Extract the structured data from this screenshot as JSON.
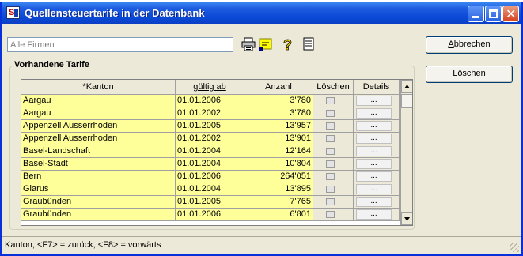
{
  "window": {
    "title": "Quellensteuertarife in der Datenbank"
  },
  "filter": {
    "placeholder": "Alle Firmen"
  },
  "buttons": {
    "cancel": "Abbrechen",
    "delete": "Löschen",
    "cancel_key": "A",
    "delete_key": "L"
  },
  "group": {
    "label": "Vorhandene Tarife"
  },
  "columns": [
    "*Kanton",
    "gültig ab",
    "Anzahl",
    "Löschen",
    "Details"
  ],
  "details_button_label": "...",
  "rows": [
    {
      "kanton": "Aargau",
      "gueltig": "01.01.2006",
      "anzahl": "3'780"
    },
    {
      "kanton": "Aargau",
      "gueltig": "01.01.2002",
      "anzahl": "3'780"
    },
    {
      "kanton": "Appenzell Ausserrhoden",
      "gueltig": "01.01.2005",
      "anzahl": "13'957"
    },
    {
      "kanton": "Appenzell Ausserrhoden",
      "gueltig": "01.01.2002",
      "anzahl": "13'901"
    },
    {
      "kanton": "Basel-Landschaft",
      "gueltig": "01.01.2004",
      "anzahl": "12'164"
    },
    {
      "kanton": "Basel-Stadt",
      "gueltig": "01.01.2004",
      "anzahl": "10'804"
    },
    {
      "kanton": "Bern",
      "gueltig": "01.01.2006",
      "anzahl": "264'051"
    },
    {
      "kanton": "Glarus",
      "gueltig": "01.01.2004",
      "anzahl": "13'895"
    },
    {
      "kanton": "Graubünden",
      "gueltig": "01.01.2005",
      "anzahl": "7'765"
    },
    {
      "kanton": "Graubünden",
      "gueltig": "01.01.2006",
      "anzahl": "6'801"
    }
  ],
  "status": {
    "text": "Kanton, <F7> = zurück, <F8> = vorwärts"
  },
  "icons": [
    "printer-icon",
    "note-icon",
    "help-icon",
    "list-icon"
  ],
  "colors": {
    "row_highlight": "#FFFF99",
    "titlebar": "#0A48D6",
    "window_bg": "#ECE9D8"
  }
}
